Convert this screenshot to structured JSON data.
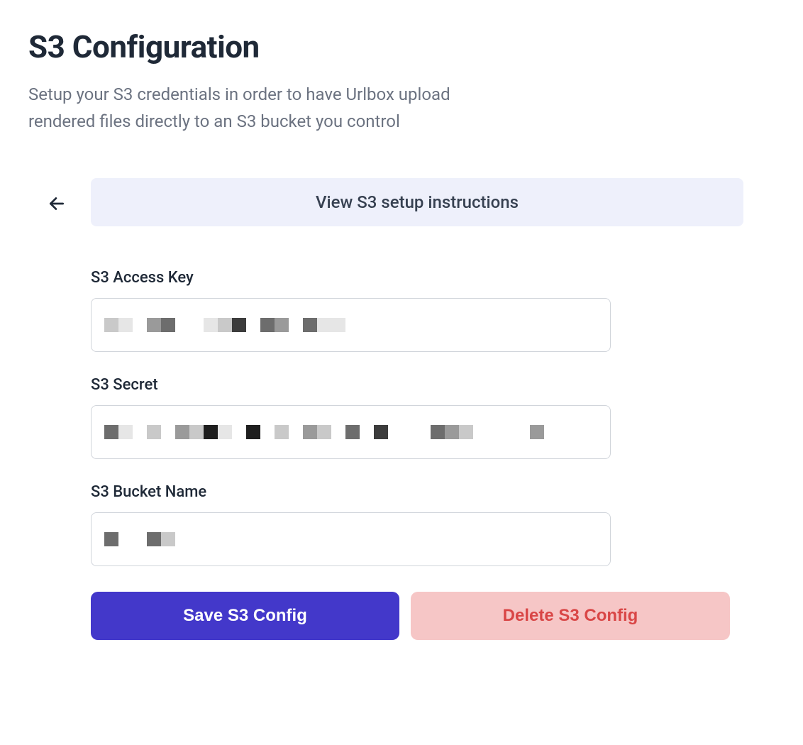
{
  "header": {
    "title": "S3 Configuration",
    "subtitle": "Setup your S3 credentials in order to have Urlbox upload rendered files directly to an S3 bucket you control"
  },
  "banner": {
    "instructions_label": "View S3 setup instructions"
  },
  "form": {
    "access_key": {
      "label": "S3 Access Key",
      "value": "[redacted]"
    },
    "secret": {
      "label": "S3 Secret",
      "value": "[redacted]"
    },
    "bucket_name": {
      "label": "S3 Bucket Name",
      "value": "[redacted]"
    }
  },
  "actions": {
    "save_label": "Save S3 Config",
    "delete_label": "Delete S3 Config"
  }
}
